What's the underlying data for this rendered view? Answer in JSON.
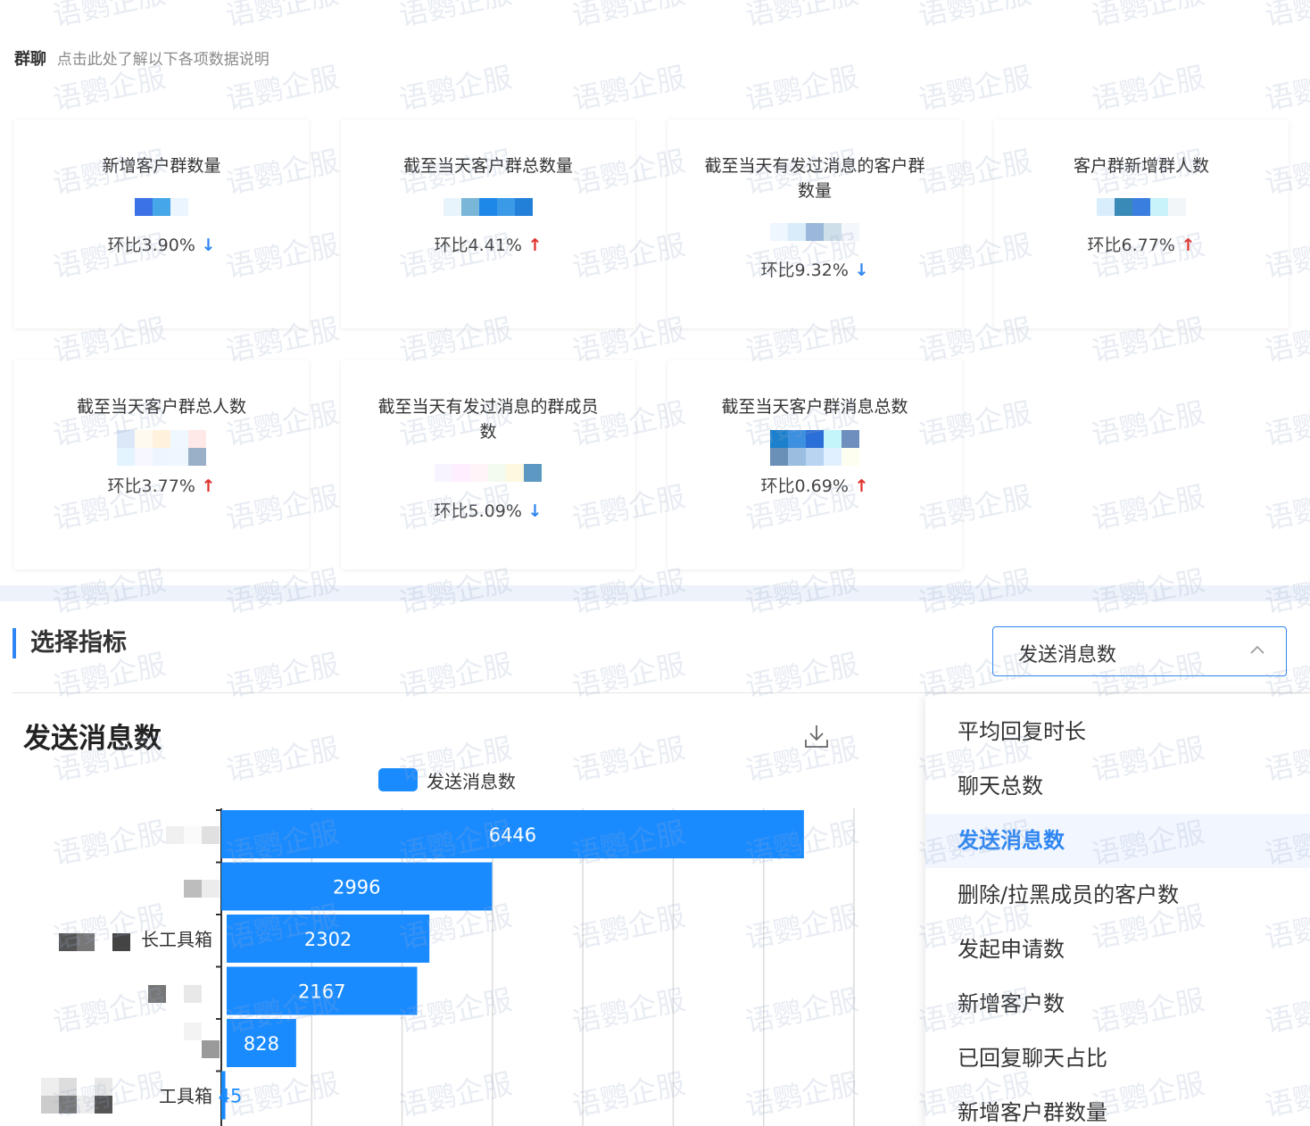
{
  "header": {
    "title": "群聊",
    "help_link": "点击此处了解以下各项数据说明"
  },
  "cards": [
    {
      "label": "新增客户群数量",
      "ratio": "环比3.90%",
      "trend": "down"
    },
    {
      "label": "截至当天客户群总数量",
      "ratio": "环比4.41%",
      "trend": "up"
    },
    {
      "label": "截至当天有发过消息的客户群数量",
      "ratio": "环比9.32%",
      "trend": "down"
    },
    {
      "label": "客户群新增群人数",
      "ratio": "环比6.77%",
      "trend": "up"
    },
    {
      "label": "截至当天客户群总人数",
      "ratio": "环比3.77%",
      "trend": "up"
    },
    {
      "label": "截至当天有发过消息的群成员数",
      "ratio": "环比5.09%",
      "trend": "down"
    },
    {
      "label": "截至当天客户群消息总数",
      "ratio": "环比0.69%",
      "trend": "up"
    }
  ],
  "metric_selector": {
    "heading": "选择指标",
    "selected": "发送消息数",
    "options": [
      "平均回复时长",
      "聊天总数",
      "发送消息数",
      "删除/拉黑成员的客户数",
      "发起申请数",
      "新增客户数",
      "已回复聊天占比",
      "新增客户群数量"
    ]
  },
  "watermark": "语鹦企服",
  "chart_data": {
    "type": "bar",
    "orientation": "horizontal",
    "title": "发送消息数",
    "legend": [
      "发送消息数"
    ],
    "categories": [
      "",
      "",
      "长工具箱",
      "",
      "",
      "工具箱"
    ],
    "values": [
      6446,
      2996,
      2302,
      2167,
      828,
      45
    ],
    "color": "#1a8bff",
    "grid": true
  },
  "colors": {
    "accent": "#2f86f2",
    "bar": "#1a8bff",
    "up": "#e0302b",
    "down": "#2f86f2"
  }
}
